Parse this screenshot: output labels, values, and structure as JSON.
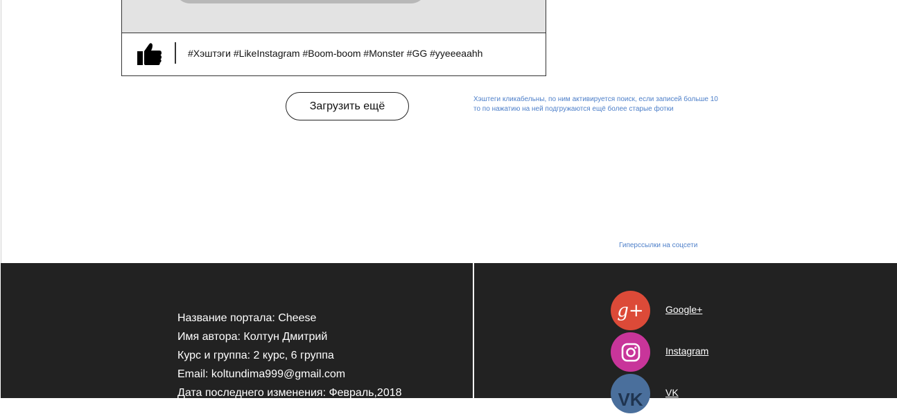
{
  "post": {
    "hashtags": [
      "#Хэштэги",
      "#LikeInstagram",
      "#Boom-boom",
      "#Monster",
      "#GG",
      "#yyeeeaahh"
    ]
  },
  "load_more": {
    "label": "Загрузить ещё"
  },
  "notes": {
    "hashtags_line1": "Хэштеги кликабельны, по ним активируется поиск, если записей больше 10",
    "hashtags_line2": "то по нажатию на ней подгружаются ещё более старые фотки",
    "links": "Гиперссылки на соцсети"
  },
  "footer": {
    "info": [
      "Название портала: Cheese",
      "Имя автора: Колтун Дмитрий",
      "Курс и группа: 2 курс, 6 группа",
      "Email: koltundima999@gmail.com",
      "Дата последнего изменения: Февраль,2018"
    ],
    "social": [
      {
        "label": "Google+",
        "icon": "google-plus-icon",
        "color": "#dc4a38"
      },
      {
        "label": "Instagram",
        "icon": "instagram-icon",
        "color": "#c8359a"
      },
      {
        "label": "VK",
        "icon": "vk-icon",
        "color": "#4a6f9c"
      }
    ]
  },
  "colors": {
    "footer_bg": "#222222",
    "note_text": "#4d7fc9",
    "image_placeholder": "#e3e3e3"
  }
}
